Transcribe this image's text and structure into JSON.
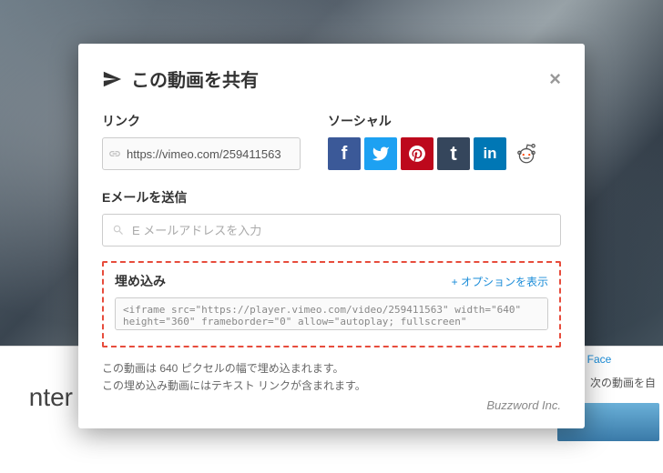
{
  "modal": {
    "title": "この動画を共有",
    "link": {
      "label": "リンク",
      "value": "https://vimeo.com/259411563"
    },
    "social": {
      "label": "ソーシャル"
    },
    "email": {
      "label": "Eメールを送信",
      "placeholder": "E メールアドレスを入力"
    },
    "embed": {
      "label": "埋め込み",
      "opt_toggle": "+ オプションを表示",
      "code": "<iframe src=\"https://player.vimeo.com/video/259411563\" width=\"640\" height=\"360\" frameborder=\"0\" allow=\"autoplay; fullscreen\""
    },
    "footer": {
      "line1": "この動画は 640 ピクセルの幅で埋め込まれます。",
      "line2": "この埋め込み動画にはテキスト リンクが含まれます。"
    },
    "brand": "Buzzword Inc."
  },
  "background": {
    "bottom_left": "nter",
    "north_face": "North Face",
    "autoplay_next": "次の動画を自"
  }
}
